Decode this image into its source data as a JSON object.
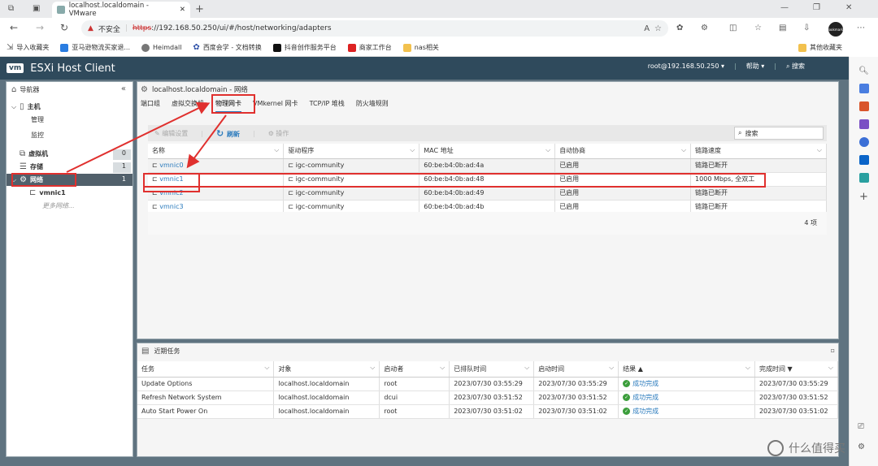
{
  "browser": {
    "tab_title": "localhost.localdomain - VMware",
    "insecure_label": "不安全",
    "url_scheme": "https",
    "url_rest": "://192.168.50.250/ui/#/host/networking/adapters",
    "profile_badge": "Bookmarks",
    "bookmarks": [
      "导入收藏夹",
      "亚马逊物流买家退...",
      "Heimdall",
      "西度会学 - 文档转换",
      "抖音创作服务平台",
      "商家工作台",
      "nas相关"
    ],
    "other_bookmarks": "其他收藏夹"
  },
  "app": {
    "logo": "vm",
    "title": "ESXi Host Client",
    "user": "root@192.168.50.250 ▾",
    "help": "帮助 ▾",
    "search": "搜索"
  },
  "navigator": {
    "title": "导航器",
    "host": "主机",
    "manage": "管理",
    "monitor": "监控",
    "vms": "虚拟机",
    "vms_count": "0",
    "storage": "存储",
    "storage_count": "1",
    "network": "网络",
    "network_count": "1",
    "vmnic": "vmnic1",
    "more": "更多网络..."
  },
  "main": {
    "title": "localhost.localdomain - 网络",
    "tabs": [
      "端口组",
      "虚拟交换机",
      "物理网卡",
      "VMkernel 网卡",
      "TCP/IP 堆栈",
      "防火墙规则"
    ],
    "toolbar": {
      "edit": "编辑设置",
      "refresh": "刷新",
      "actions": "操作",
      "search": "搜索"
    },
    "columns": [
      "名称",
      "驱动程序",
      "MAC 地址",
      "自动协商",
      "链路速度"
    ],
    "rows": [
      [
        "vmnic0",
        "igc-community",
        "60:be:b4:0b:ad:4a",
        "已启用",
        "链路已断开"
      ],
      [
        "vmnic1",
        "igc-community",
        "60:be:b4:0b:ad:48",
        "已启用",
        "1000 Mbps, 全双工"
      ],
      [
        "vmnic2",
        "igc-community",
        "60:be:b4:0b:ad:49",
        "已启用",
        "链路已断开"
      ],
      [
        "vmnic3",
        "igc-community",
        "60:be:b4:0b:ad:4b",
        "已启用",
        "链路已断开"
      ]
    ],
    "count": "4 项"
  },
  "tasks": {
    "title": "近期任务",
    "columns": [
      "任务",
      "对象",
      "启动者",
      "已排队时间",
      "启动时间",
      "结果 ▲",
      "完成时间 ▼"
    ],
    "rows": [
      [
        "Update Options",
        "localhost.localdomain",
        "root",
        "2023/07/30 03:55:29",
        "2023/07/30 03:55:29",
        "成功完成",
        "2023/07/30 03:55:29"
      ],
      [
        "Refresh Network System",
        "localhost.localdomain",
        "dcui",
        "2023/07/30 03:51:52",
        "2023/07/30 03:51:52",
        "成功完成",
        "2023/07/30 03:51:52"
      ],
      [
        "Auto Start Power On",
        "localhost.localdomain",
        "root",
        "2023/07/30 03:51:02",
        "2023/07/30 03:51:02",
        "成功完成",
        "2023/07/30 03:51:02"
      ]
    ]
  },
  "watermark": "什么值得买"
}
